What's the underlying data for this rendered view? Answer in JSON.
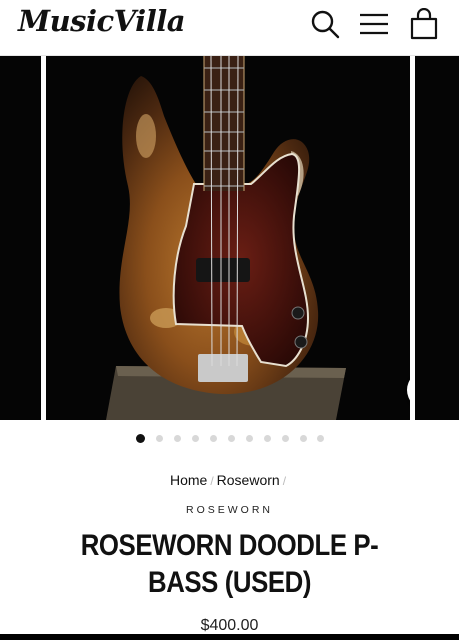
{
  "header": {
    "logo_text": "MusicVilla",
    "icons": [
      "search-icon",
      "menu-icon",
      "cart-icon"
    ]
  },
  "gallery": {
    "slide_count": 11,
    "active_index": 0,
    "zoom_icon": "zoom-icon"
  },
  "breadcrumb": {
    "items": [
      "Home",
      "Roseworn"
    ],
    "separator": "/"
  },
  "product": {
    "vendor": "ROSEWORN",
    "title": "ROSEWORN DOODLE P-BASS (USED)",
    "price": "$400.00"
  },
  "colors": {
    "text": "#111111",
    "dot_inactive": "#d8d8d8",
    "dot_active": "#111111",
    "image_background": "#050505"
  }
}
